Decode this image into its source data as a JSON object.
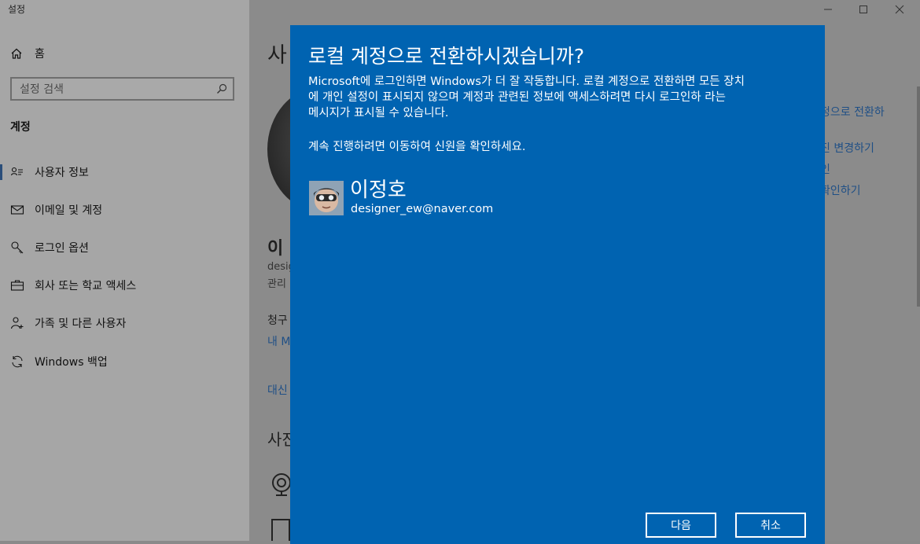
{
  "app": {
    "title": "설정"
  },
  "sidebar": {
    "home_label": "홈",
    "search_placeholder": "설정 검색",
    "section_title": "계정",
    "items": [
      {
        "label": "사용자 정보",
        "icon": "person-card-icon",
        "selected": true
      },
      {
        "label": "이메일 및 계정",
        "icon": "mail-icon"
      },
      {
        "label": "로그인 옵션",
        "icon": "key-icon"
      },
      {
        "label": "회사 또는 학교 액세스",
        "icon": "briefcase-icon"
      },
      {
        "label": "가족 및 다른 사용자",
        "icon": "person-add-icon"
      },
      {
        "label": "Windows 백업",
        "icon": "sync-icon"
      }
    ]
  },
  "background": {
    "heading_fragment": "사",
    "name_fragment": "이",
    "email_fragment": "desig",
    "role_fragment": "관리",
    "billing_fragment": "청구",
    "my_link_fragment": "내 M",
    "alt_link_fragment": "대신",
    "photo_section_fragment": "사진",
    "right_links": [
      "정으로 전환하",
      "진 변경하기",
      "인",
      "확인하기"
    ]
  },
  "dialog": {
    "title": "로컬 계정으로 전환하시겠습니까?",
    "body_line1": "Microsoft에 로그인하면 Windows가 더 잘 작동합니다. 로컬 계정으로 전환하면 모든 장치",
    "body_line2": "에 개인 설정이 표시되지 않으며 계정과 관련된 정보에 액세스하려면 다시 로그인하 라는",
    "body_line3": "메시지가 표시될 수 있습니다.",
    "note": "계속 진행하려면 이동하여 신원을 확인하세요.",
    "user_name": "이정호",
    "user_email": "designer_ew@naver.com",
    "next_label": "다음",
    "cancel_label": "취소"
  },
  "colors": {
    "dialog_bg": "#0063b1",
    "sidebar_bg": "#a6a6a6",
    "main_bg": "#8b8b8b",
    "link": "#1f4f86"
  }
}
